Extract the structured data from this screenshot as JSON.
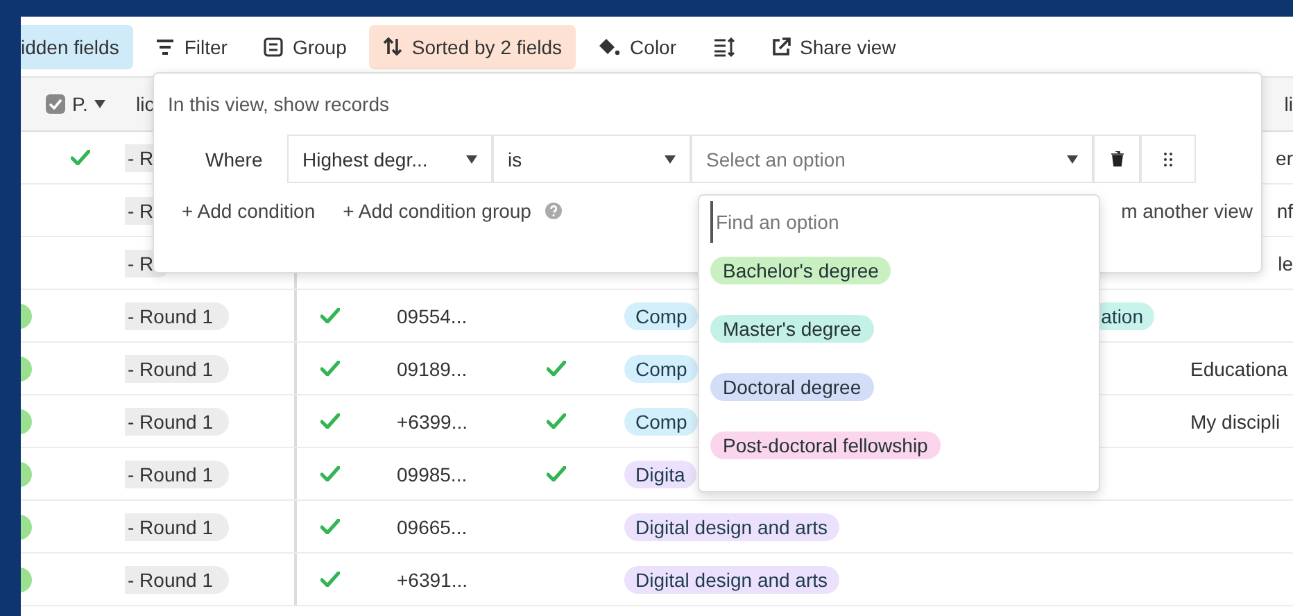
{
  "toolbar": {
    "items": [
      {
        "kind": "hidden",
        "label": "idden fields"
      },
      {
        "kind": "filter",
        "label": "Filter"
      },
      {
        "kind": "group",
        "label": "Group"
      },
      {
        "kind": "sort",
        "label": "Sorted by 2 fields"
      },
      {
        "kind": "color",
        "label": "Color"
      },
      {
        "kind": "rowheight"
      },
      {
        "kind": "share",
        "label": "Share view"
      }
    ]
  },
  "table": {
    "header": [
      {
        "kind": "blank"
      },
      {
        "kind": "checkbox",
        "label": "P."
      },
      {
        "kind": "text",
        "label": "lic"
      },
      {
        "kind": "covered"
      },
      {
        "kind": "covered"
      },
      {
        "kind": "covered"
      },
      {
        "kind": "covered"
      },
      {
        "kind": "edge",
        "label": "li"
      }
    ],
    "rows": [
      {
        "covered": true,
        "flag": false,
        "picked": true,
        "round": "- R",
        "note": "er"
      },
      {
        "covered": true,
        "flag": false,
        "picked": false,
        "round": "- R",
        "note": "nf"
      },
      {
        "covered": true,
        "flag": false,
        "picked": false,
        "round": "- R",
        "note": "le"
      },
      {
        "flag": true,
        "picked": false,
        "round": "- Round 1",
        "check_a": true,
        "phone": "09554...",
        "check_b": false,
        "tags": [
          {
            "label": "Comp",
            "color": "#d3effb"
          },
          {
            "label": "ation",
            "color": "#c8f3ea"
          }
        ]
      },
      {
        "flag": true,
        "picked": false,
        "round": "- Round 1",
        "check_a": true,
        "phone": "09189...",
        "check_b": true,
        "tags": [
          {
            "label": "Comp",
            "color": "#d3effb"
          }
        ],
        "note": "Educationa"
      },
      {
        "flag": true,
        "picked": false,
        "round": "- Round 1",
        "check_a": true,
        "phone": "+6399...",
        "check_b": true,
        "tags": [
          {
            "label": "Comp",
            "color": "#d3effb"
          }
        ],
        "note": "My discipli"
      },
      {
        "flag": true,
        "picked": false,
        "round": "- Round 1",
        "check_a": true,
        "phone": "09985...",
        "check_b": true,
        "tags": [
          {
            "label": "Digita",
            "color": "#ebe1fc"
          }
        ]
      },
      {
        "flag": true,
        "picked": false,
        "round": "- Round 1",
        "check_a": true,
        "phone": "09665...",
        "check_b": false,
        "tags": [
          {
            "label": "Digital design and arts",
            "color": "#ebe1fc"
          }
        ]
      },
      {
        "flag": true,
        "picked": false,
        "round": "- Round 1",
        "check_a": true,
        "phone": "+6391...",
        "check_b": false,
        "tags": [
          {
            "label": "Digital design and arts",
            "color": "#ebe1fc"
          }
        ]
      }
    ]
  },
  "filter_popover": {
    "title": "In this view, show records",
    "prefix": "Where",
    "field": "Highest degr...",
    "operator": "is",
    "value": {
      "placeholder": "Select an option"
    },
    "actions": [
      "+ Add condition",
      "+ Add condition group"
    ],
    "link": "m another view"
  },
  "dropdown": {
    "search": {
      "placeholder": "Find an option"
    },
    "options": [
      {
        "label": "Bachelor's degree",
        "color": "#c9f0c0"
      },
      {
        "label": "Master's degree",
        "color": "#c4f1e5"
      },
      {
        "label": "Doctoral degree",
        "color": "#d2ddf8"
      },
      {
        "label": "Post-doctoral fellowship",
        "color": "#fbd5ec"
      }
    ]
  }
}
